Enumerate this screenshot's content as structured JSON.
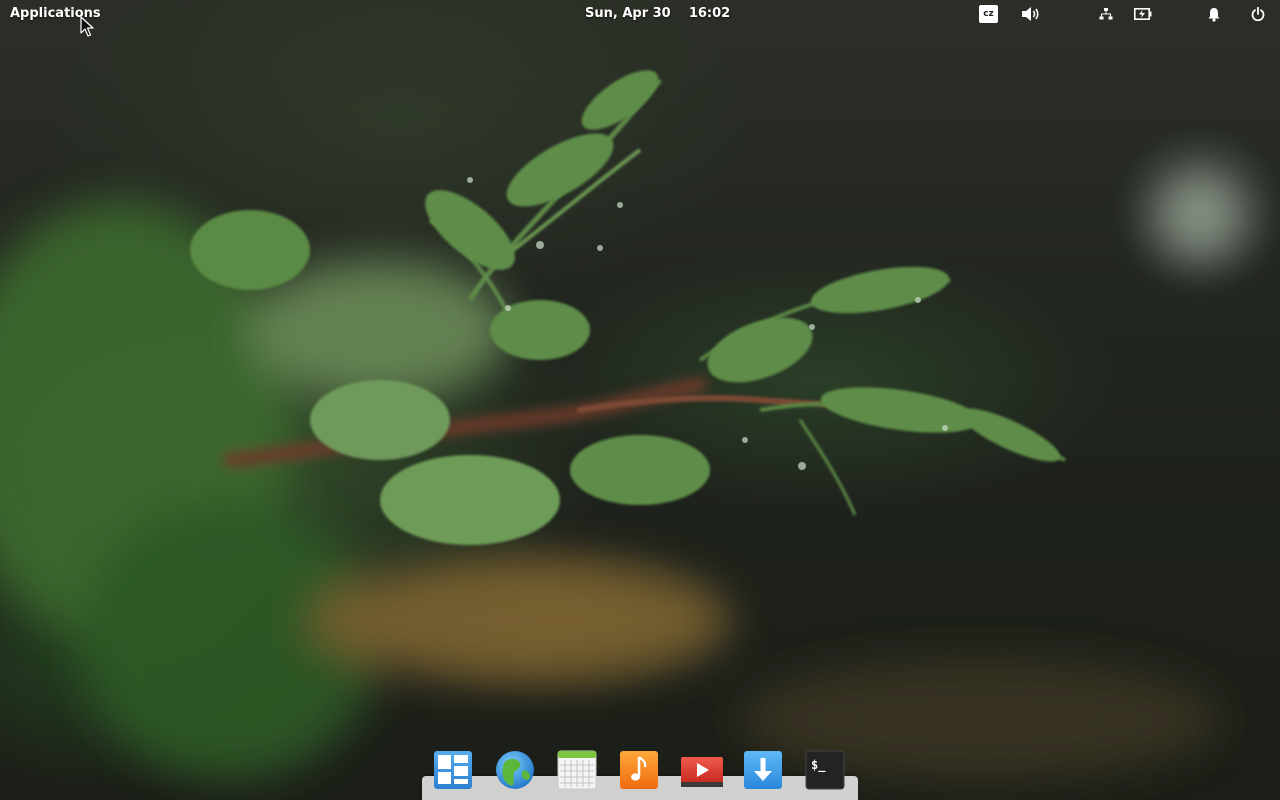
{
  "panel": {
    "applications_label": "Applications",
    "clock_label": "Sun, Apr 30    16:02",
    "keyboard_layout": "cz",
    "indicators": [
      "keyboard-layout-icon",
      "volume-icon",
      "network-icon",
      "battery-icon",
      "notifications-icon",
      "power-icon"
    ]
  },
  "dock": {
    "apps": [
      {
        "icon": "multitasking-view-icon"
      },
      {
        "icon": "web-browser-icon"
      },
      {
        "icon": "calendar-icon"
      },
      {
        "icon": "music-icon"
      },
      {
        "icon": "videos-icon"
      },
      {
        "icon": "appcenter-download-icon"
      },
      {
        "icon": "terminal-icon",
        "glyph": "$_"
      }
    ]
  },
  "colors": {
    "panel_text": "#ffffff",
    "dock_shelf": "#f0f0f0",
    "wallpaper_dark": "#1f231c",
    "foliage_green": "#4f7a3a"
  }
}
